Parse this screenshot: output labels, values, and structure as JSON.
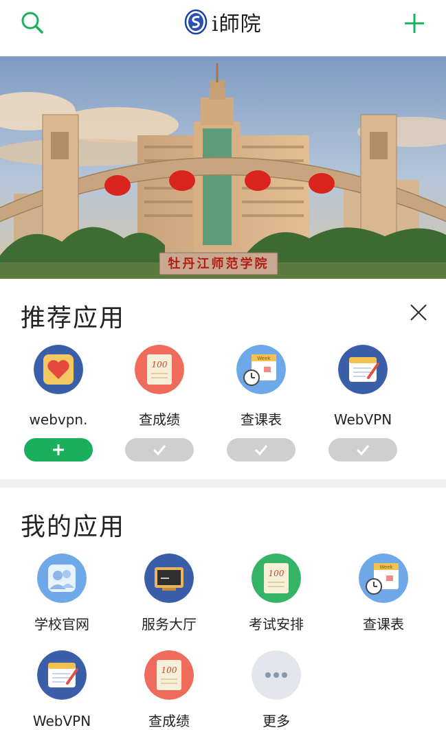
{
  "header": {
    "logo_text": "i師院"
  },
  "banner": {
    "gate_sign": "牡丹江师范学院"
  },
  "recommended": {
    "title": "推荐应用",
    "items": [
      {
        "label": "webvpn.",
        "status": "add"
      },
      {
        "label": "查成绩",
        "status": "added"
      },
      {
        "label": "查课表",
        "status": "added"
      },
      {
        "label": "WebVPN",
        "status": "added"
      }
    ]
  },
  "my_apps": {
    "title": "我的应用",
    "items": [
      {
        "label": "学校官网"
      },
      {
        "label": "服务大厅"
      },
      {
        "label": "考试安排"
      },
      {
        "label": "查课表"
      },
      {
        "label": "WebVPN"
      },
      {
        "label": "查成绩"
      },
      {
        "label": "更多"
      }
    ]
  },
  "icons": {
    "exam_score": "100",
    "week_label": "Week"
  },
  "colors": {
    "accent": "#1aaf5d",
    "navy": "#3a5ea8",
    "red": "#ef6b5c",
    "green": "#35b467",
    "sky": "#6fa8e8",
    "grey": "#e3e6ec"
  }
}
